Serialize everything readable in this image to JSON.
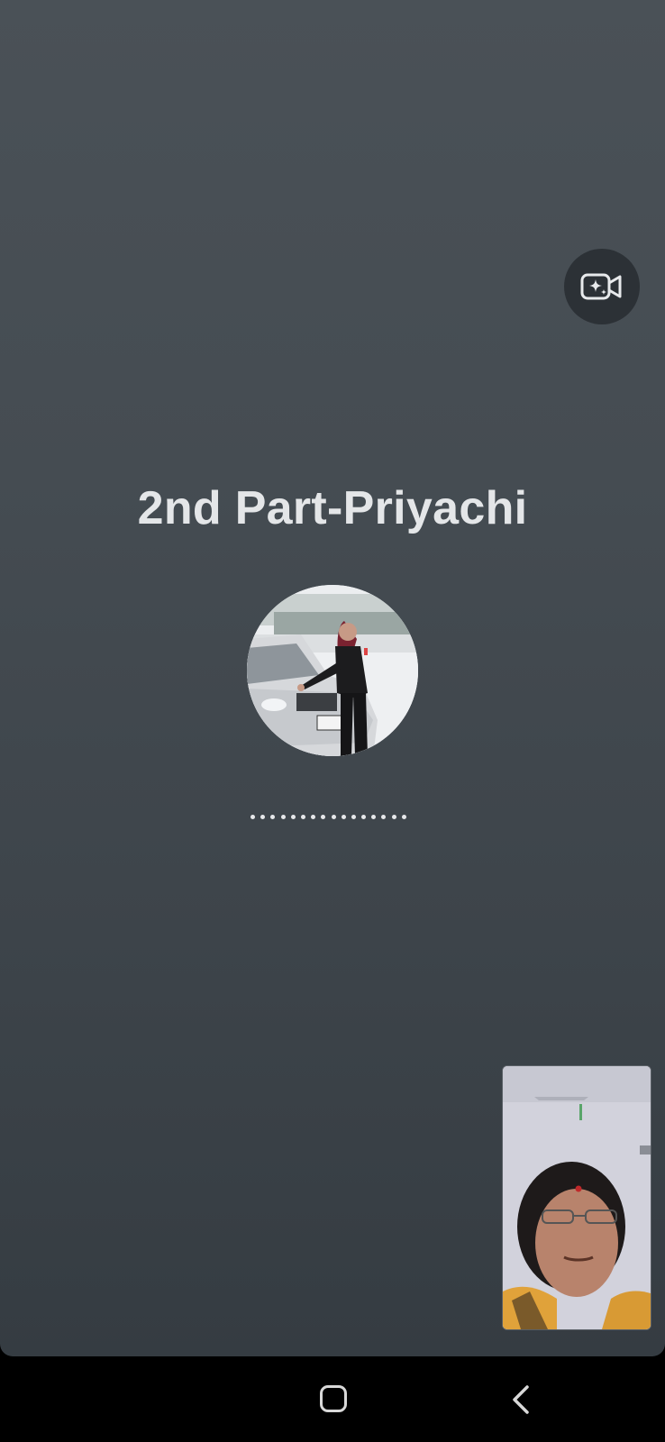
{
  "call": {
    "contact_name": "2nd Part-Priyachi",
    "status_indicator": "ringing-dots",
    "dot_count": 16
  },
  "controls": {
    "effects_icon": "video-sparkle-icon"
  },
  "self_view": {
    "icon": "camera-preview"
  },
  "navigation": {
    "home_icon": "home-square-icon",
    "back_icon": "back-chevron-icon"
  },
  "colors": {
    "panel_top": "#4a5157",
    "panel_bottom": "#353c42",
    "name_text": "#e4e6e8",
    "effects_button_bg": "#2c3136",
    "nav_bar": "#000000"
  }
}
